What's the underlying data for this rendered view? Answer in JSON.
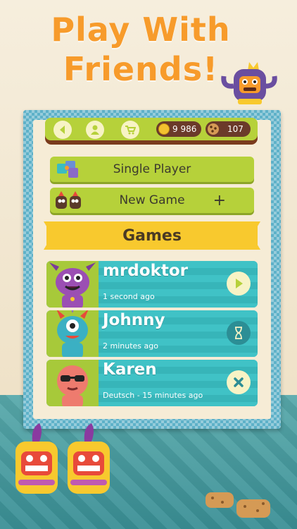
{
  "headline": {
    "line1": "Play With",
    "line2": "Friends!"
  },
  "topbar": {
    "coins": "9 986",
    "cookies": "107"
  },
  "menu": {
    "single_player": "Single Player",
    "new_game": "New Game",
    "plus": "+"
  },
  "section_title": "Games",
  "games": [
    {
      "name": "mrdoktor",
      "time": "1 second ago",
      "action": "play",
      "avatar_color": "#9b4fb3"
    },
    {
      "name": "Johnny",
      "time": "2 minutes ago",
      "action": "hourglass",
      "avatar_color": "#3bb0c3"
    },
    {
      "name": "Karen",
      "time": "Deutsch - 15 minutes ago",
      "action": "close",
      "avatar_color": "#ee7b6e"
    }
  ],
  "colors": {
    "green": "#b6d13a",
    "teal": "#3bbcc1",
    "orange": "#f79b2b",
    "yellow": "#f8c92e"
  }
}
